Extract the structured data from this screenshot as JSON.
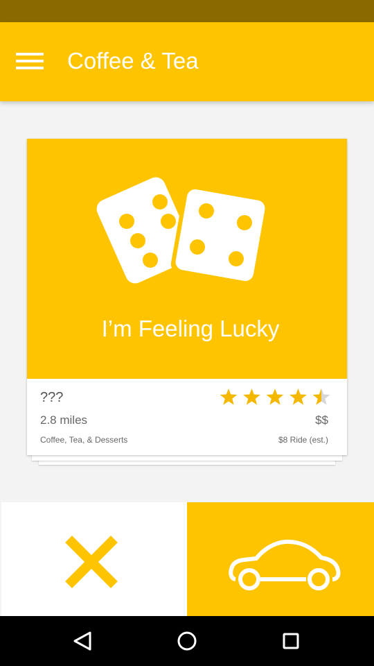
{
  "app_bar": {
    "title": "Coffee & Tea"
  },
  "card": {
    "hero_label": "I’m Feeling Lucky",
    "place_name": "???",
    "distance": "2.8 miles",
    "category": "Coffee, Tea, & Desserts",
    "price": "$$",
    "ride_estimate": "$8 Ride (est.)",
    "rating": 4.5,
    "rating_max": 5
  },
  "actions": {
    "dismiss_icon": "close-icon",
    "ride_icon": "car-icon"
  },
  "colors": {
    "accent": "#ffc400",
    "status_bar": "#8a6a00",
    "star": "#f5b800",
    "star_empty": "#d6d6d6"
  },
  "nav": {
    "icons": [
      "back-icon",
      "home-icon",
      "recents-icon"
    ]
  }
}
